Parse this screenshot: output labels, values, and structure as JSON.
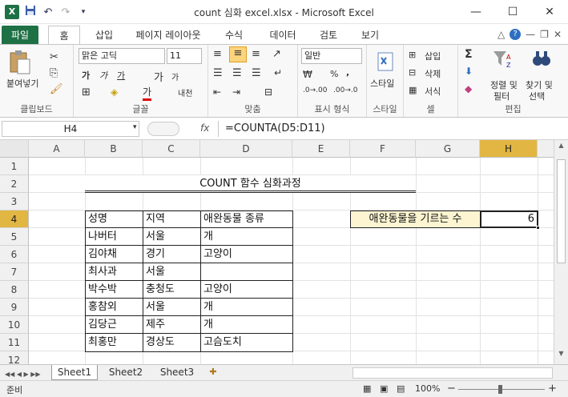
{
  "window": {
    "title": "count 심화 excel.xlsx  -  Microsoft Excel",
    "app_icon": "X",
    "min_icon": "—",
    "max_icon": "☐",
    "close_icon": "✕"
  },
  "ribbon_tabs": [
    "파일",
    "홈",
    "삽입",
    "페이지 레이아웃",
    "수식",
    "데이터",
    "검토",
    "보기"
  ],
  "ribbon": {
    "clipboard": {
      "label": "클립보드",
      "paste": "붙여넣기"
    },
    "font": {
      "label": "글꼴",
      "name": "맑은 고딕",
      "size": "11",
      "bold": "가",
      "italic": "가",
      "underline": "가",
      "grow": "가",
      "shrink": "가",
      "color": "가",
      "phonetic": "내천"
    },
    "alignment": {
      "label": "맞춤"
    },
    "number": {
      "label": "표시 형식",
      "format": "일반",
      "percent": "%",
      "comma": ","
    },
    "styles": {
      "label": "스타일",
      "button": "스타일"
    },
    "cells": {
      "label": "셀",
      "insert": "삽입",
      "delete": "삭제",
      "format": "서식"
    },
    "editing": {
      "label": "편집",
      "sort": "정렬 및",
      "sort2": "필터",
      "find": "찾기 및",
      "find2": "선택"
    }
  },
  "formula_bar": {
    "name_box": "H4",
    "fx": "fx",
    "formula": "=COUNTA(D5:D11)"
  },
  "columns": [
    "A",
    "B",
    "C",
    "D",
    "E",
    "F",
    "G",
    "H"
  ],
  "rows": [
    "1",
    "2",
    "3",
    "4",
    "5",
    "6",
    "7",
    "8",
    "9",
    "10",
    "11",
    "12"
  ],
  "selected_column": "H",
  "selected_row": "4",
  "sheet": {
    "title": "COUNT 함수 심화과정",
    "headers": [
      "성명",
      "지역",
      "애완동물 종류"
    ],
    "data": [
      [
        "나버터",
        "서울",
        "개"
      ],
      [
        "김야채",
        "경기",
        "고양이"
      ],
      [
        "최사과",
        "서울",
        ""
      ],
      [
        "박수박",
        "충청도",
        "고양이"
      ],
      [
        "홍참외",
        "서울",
        "개"
      ],
      [
        "김당근",
        "제주",
        "개"
      ],
      [
        "최홍만",
        "경상도",
        "고슴도치"
      ]
    ],
    "label_cell": "애완동물을 기르는 수",
    "result_cell": "6"
  },
  "sheet_tabs": [
    "Sheet1",
    "Sheet2",
    "Sheet3"
  ],
  "status": {
    "ready": "준비",
    "zoom": "100%",
    "zoom_minus": "−",
    "zoom_plus": "+"
  },
  "colors": {
    "excel_green": "#1e7145",
    "selected_header": "#e2b642",
    "label_fill": "#fdf5d2"
  }
}
